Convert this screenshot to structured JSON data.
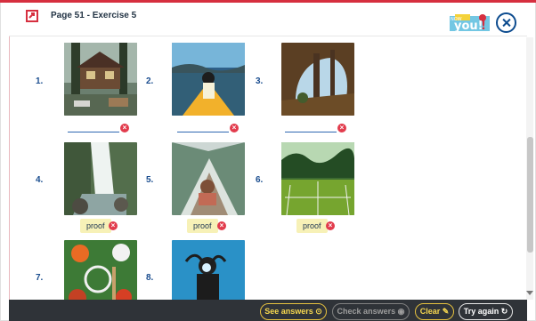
{
  "header": {
    "title": "Page 51 - Exercise 5",
    "brand_small": "NOW",
    "brand_main": "you!",
    "brand_mark": "!"
  },
  "items": [
    {
      "number": "1.",
      "answer": "",
      "state": "wrong",
      "image": "cabin-icon"
    },
    {
      "number": "2.",
      "answer": "",
      "state": "wrong",
      "image": "canoe-icon"
    },
    {
      "number": "3.",
      "answer": "",
      "state": "wrong",
      "image": "cave-icon"
    },
    {
      "number": "4.",
      "answer": "proof",
      "state": "wrong",
      "image": "waterfall-icon"
    },
    {
      "number": "5.",
      "answer": "proof",
      "state": "wrong",
      "image": "tent-icon"
    },
    {
      "number": "6.",
      "answer": "proof",
      "state": "wrong",
      "image": "tennis-court-icon"
    },
    {
      "number": "7.",
      "answer": "",
      "state": "none",
      "image": "sports-gear-icon"
    },
    {
      "number": "8.",
      "answer": "",
      "state": "none",
      "image": "diver-icon"
    }
  ],
  "footer": {
    "see_answers": "See answers",
    "check_answers": "Check answers",
    "clear": "Clear",
    "try_again": "Try again"
  },
  "colors": {
    "accent": "#d62f3f",
    "number_blue": "#1a4d8f",
    "footer_bg": "#2f3338",
    "button_yellow": "#f7d84f"
  }
}
